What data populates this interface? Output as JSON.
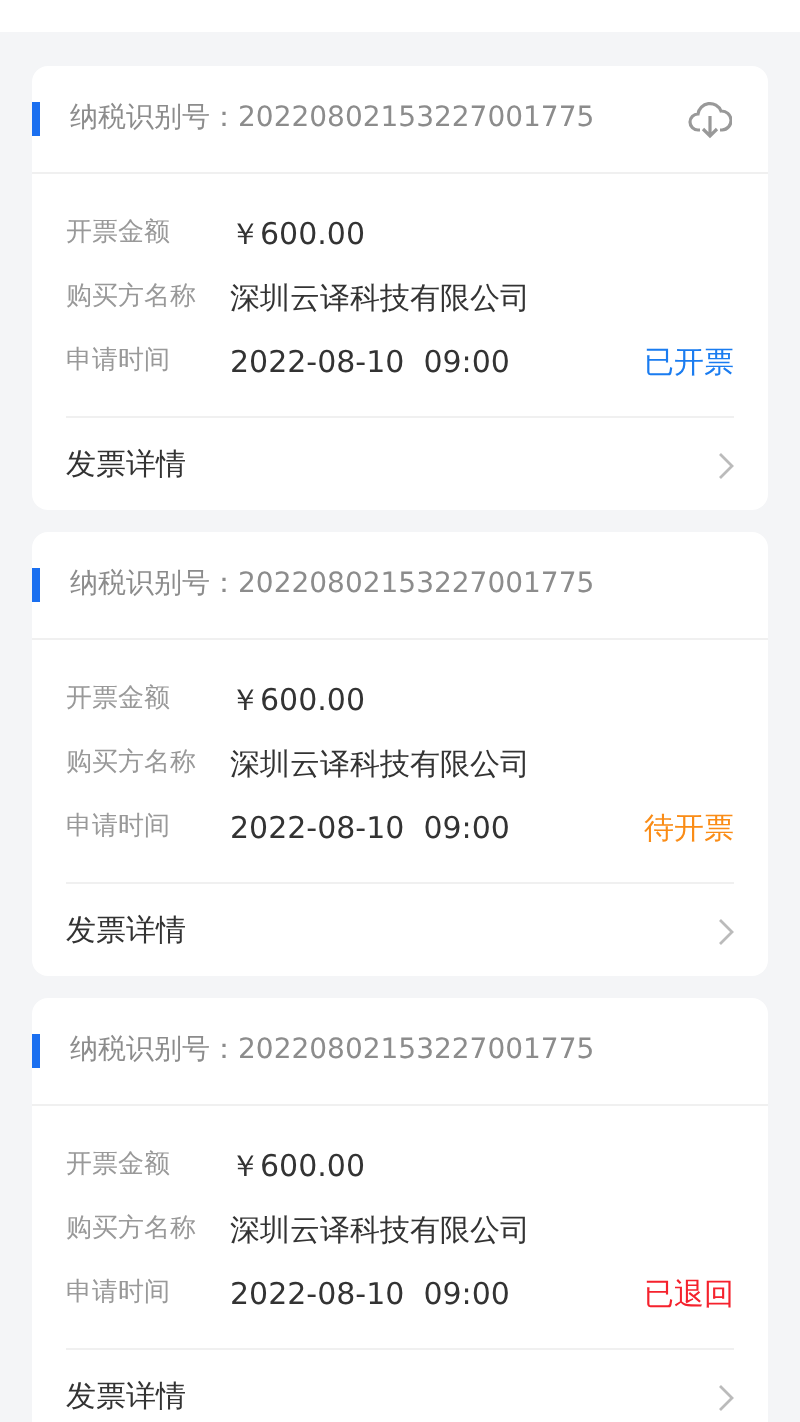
{
  "invoices": [
    {
      "tax_id_label": "纳税识别号：",
      "tax_id": "20220802153227001775",
      "downloadable": true,
      "fields": [
        {
          "label": "开票金额",
          "value": "￥600.00"
        },
        {
          "label": "购买方名称",
          "value": "深圳云译科技有限公司"
        },
        {
          "label": "申请时间",
          "value": "2022-08-10  09:00"
        }
      ],
      "status": "已开票",
      "color": "#1a7cf0",
      "detail": "发票详情"
    },
    {
      "tax_id_label": "纳税识别号：",
      "tax_id": "20220802153227001775",
      "downloadable": false,
      "fields": [
        {
          "label": "开票金额",
          "value": "￥600.00"
        },
        {
          "label": "购买方名称",
          "value": "深圳云译科技有限公司"
        },
        {
          "label": "申请时间",
          "value": "2022-08-10  09:00"
        }
      ],
      "status": "待开票",
      "color": "#fa8c16",
      "detail": "发票详情"
    },
    {
      "tax_id_label": "纳税识别号：",
      "tax_id": "20220802153227001775",
      "downloadable": false,
      "fields": [
        {
          "label": "开票金额",
          "value": "￥600.00"
        },
        {
          "label": "购买方名称",
          "value": "深圳云译科技有限公司"
        },
        {
          "label": "申请时间",
          "value": "2022-08-10  09:00"
        }
      ],
      "status": "已退回",
      "color": "#f5222d",
      "detail": "发票详情"
    }
  ]
}
